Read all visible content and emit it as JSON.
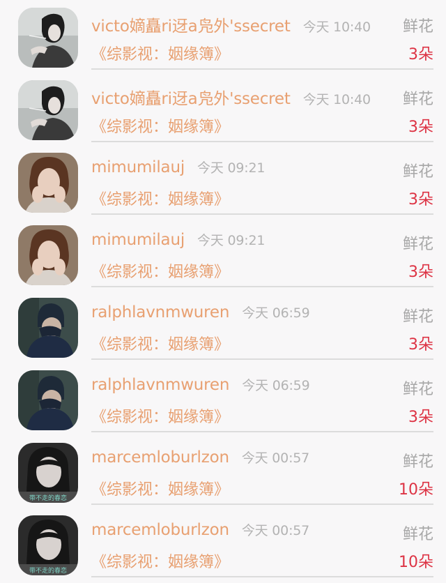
{
  "records": [
    {
      "user": "victo嫡矗ri迓a凫外'ssecret",
      "time": "今天 10:40",
      "gift": "鲜花",
      "book": "《综影视：姻缘簿》",
      "count": "3朵"
    },
    {
      "user": "victo嫡矗ri迓a凫外'ssecret",
      "time": "今天 10:40",
      "gift": "鲜花",
      "book": "《综影视：姻缘簿》",
      "count": "3朵"
    },
    {
      "user": "mimumilauj",
      "time": "今天 09:21",
      "gift": "鲜花",
      "book": "《综影视：姻缘簿》",
      "count": "3朵"
    },
    {
      "user": "mimumilauj",
      "time": "今天 09:21",
      "gift": "鲜花",
      "book": "《综影视：姻缘簿》",
      "count": "3朵"
    },
    {
      "user": "ralphlavnmwuren",
      "time": "今天 06:59",
      "gift": "鲜花",
      "book": "《综影视：姻缘簿》",
      "count": "3朵"
    },
    {
      "user": "ralphlavnmwuren",
      "time": "今天 06:59",
      "gift": "鲜花",
      "book": "《综影视：姻缘簿》",
      "count": "3朵"
    },
    {
      "user": "marcemloburlzon",
      "time": "今天 00:57",
      "gift": "鲜花",
      "book": "《综影视：姻缘簿》",
      "count": "10朵"
    },
    {
      "user": "marcemloburlzon",
      "time": "今天 00:57",
      "gift": "鲜花",
      "book": "《综影视：姻缘簿》",
      "count": "10朵"
    }
  ],
  "avatar_overlay": "带不走的春恋"
}
